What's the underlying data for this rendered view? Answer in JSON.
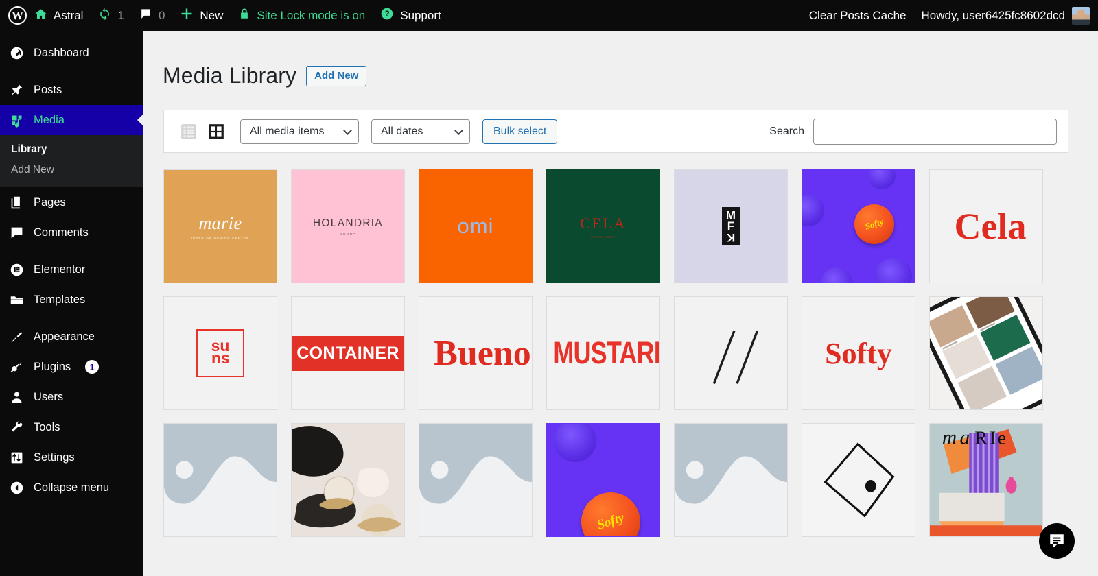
{
  "adminbar": {
    "logo_icon": "wordpress-logo-icon",
    "items": [
      {
        "icon": "home-icon",
        "label": "Astral",
        "green_icon": true
      },
      {
        "icon": "updates-icon",
        "label": "1",
        "green_icon": true,
        "muted_label": false
      },
      {
        "icon": "comment-icon",
        "label": "0",
        "muted_label": true
      },
      {
        "icon": "plus-icon",
        "label": "New",
        "green_icon": true
      },
      {
        "icon": "lock-icon",
        "label": "Site Lock mode is on",
        "green_icon": true,
        "green_label": true
      },
      {
        "icon": "help-icon",
        "label": "Support",
        "green_icon": true
      }
    ],
    "clear_cache_label": "Clear Posts Cache",
    "howdy_label": "Howdy, user6425fc8602dcd",
    "avatar": "user-avatar"
  },
  "sidebar": {
    "items": [
      {
        "icon": "dashboard-icon",
        "label": "Dashboard",
        "current": false
      },
      {
        "icon": "pin-icon",
        "label": "Posts",
        "current": false
      },
      {
        "icon": "media-icon",
        "label": "Media",
        "current": true
      },
      {
        "icon": "pages-icon",
        "label": "Pages",
        "current": false
      },
      {
        "icon": "comments-icon",
        "label": "Comments",
        "current": false
      },
      {
        "icon": "elementor-icon",
        "label": "Elementor",
        "current": false
      },
      {
        "icon": "templates-icon",
        "label": "Templates",
        "current": false
      },
      {
        "icon": "appearance-icon",
        "label": "Appearance",
        "current": false
      },
      {
        "icon": "plugins-icon",
        "label": "Plugins",
        "current": false,
        "badge": "1"
      },
      {
        "icon": "users-icon",
        "label": "Users",
        "current": false
      },
      {
        "icon": "tools-icon",
        "label": "Tools",
        "current": false
      },
      {
        "icon": "settings-icon",
        "label": "Settings",
        "current": false
      },
      {
        "icon": "collapse-icon",
        "label": "Collapse menu",
        "current": false
      }
    ],
    "submenu": [
      {
        "label": "Library",
        "active": true
      },
      {
        "label": "Add New",
        "active": false
      }
    ],
    "highlight_bg": "#1500a8",
    "highlight_text": "#3ddc97"
  },
  "header": {
    "title": "Media Library",
    "add_new_label": "Add New"
  },
  "toolbar": {
    "list_view_icon": "list-view-icon",
    "grid_view_icon": "grid-view-icon",
    "media_filter_value": "All media items",
    "date_filter_value": "All dates",
    "bulk_select_label": "Bulk select",
    "search_label": "Search",
    "search_value": "",
    "search_placeholder": ""
  },
  "grid": {
    "items": [
      {
        "name": "marie-logo-tan",
        "kind": "wordmark",
        "bg": "#e0a355",
        "fg": "#ffffff",
        "text": "marie",
        "sub": "INTERIOR DESIGN CENTER",
        "font": "serif",
        "size": 26,
        "italic": true
      },
      {
        "name": "holandria-logo-pink",
        "kind": "wordmark",
        "bg": "#ffc2d4",
        "fg": "#4a3a42",
        "text": "HOLANDRIA",
        "sub": "MILANO",
        "font": "sans",
        "size": 16,
        "spacing": 1.2
      },
      {
        "name": "omi-logo-orange",
        "kind": "wordmark",
        "bg": "#f96300",
        "fg": "#9bbcea",
        "text": "omi",
        "sub": "",
        "font": "sans",
        "size": 30
      },
      {
        "name": "cela-logo-green",
        "kind": "wordmark",
        "bg": "#0a4b30",
        "fg": "#cc2214",
        "text": "CELA",
        "sub": "JEWELLERY",
        "font": "serif",
        "size": 22,
        "spacing": 2
      },
      {
        "name": "mfk-logo-lavender",
        "kind": "mfk",
        "bg": "#d7d5e8",
        "fg": "#111111",
        "text": "MFK"
      },
      {
        "name": "softy-caps-purple-1",
        "kind": "caps",
        "bg": "#6633f5",
        "text": "Softy"
      },
      {
        "name": "cela-wordmark-red",
        "kind": "wordmark",
        "bg": "#f0f0f1",
        "fg": "#e02b20",
        "text": "Cela",
        "sub": "",
        "font": "serif",
        "size": 52,
        "overflow": true
      },
      {
        "name": "suns-logo-boxed",
        "kind": "suns",
        "bg": "#f0f0f1",
        "fg": "#e8332a",
        "text": "su ns"
      },
      {
        "name": "container-banner-red",
        "kind": "banner",
        "bg": "#f0f0f1",
        "band": "#e23127",
        "fg": "#ffffff",
        "text": "CONTAINER",
        "size": 25
      },
      {
        "name": "bueno-wordmark-red",
        "kind": "wordmark",
        "bg": "#f0f0f1",
        "fg": "#e02b20",
        "text": "Bueno",
        "sub": "",
        "font": "serif",
        "size": 50,
        "bold": true,
        "overflow": true
      },
      {
        "name": "mustard-wordmark-red",
        "kind": "wordmark",
        "bg": "#f0f0f1",
        "fg": "#e8332a",
        "text": "MUSTARD",
        "sub": "",
        "font": "sans",
        "size": 44,
        "bold": true,
        "condensed": true,
        "overflow": true
      },
      {
        "name": "slashes-mark",
        "kind": "slashes",
        "bg": "#f0f0f1",
        "fg": "#1d1d1d"
      },
      {
        "name": "softy-wordmark-red",
        "kind": "wordmark",
        "bg": "#f0f0f1",
        "fg": "#e02b20",
        "text": "Softy",
        "sub": "",
        "font": "serif",
        "size": 42,
        "italic": false,
        "bold": true
      },
      {
        "name": "phone-mockup-photo",
        "kind": "phone",
        "bg": "#ffffff"
      },
      {
        "name": "image-placeholder-1",
        "kind": "placeholder"
      },
      {
        "name": "ceramics-photo",
        "kind": "ceramics"
      },
      {
        "name": "image-placeholder-2",
        "kind": "placeholder"
      },
      {
        "name": "softy-caps-purple-2",
        "kind": "caps2",
        "bg": "#6633f5",
        "text": "Softy"
      },
      {
        "name": "image-placeholder-3",
        "kind": "placeholder"
      },
      {
        "name": "diamond-outline-mark",
        "kind": "diamond",
        "bg": "#f4f4f5",
        "fg": "#111111"
      },
      {
        "name": "marie-poster-collage",
        "kind": "collage",
        "text": "marie"
      }
    ]
  },
  "chat": {
    "icon": "chat-bubble-icon"
  }
}
